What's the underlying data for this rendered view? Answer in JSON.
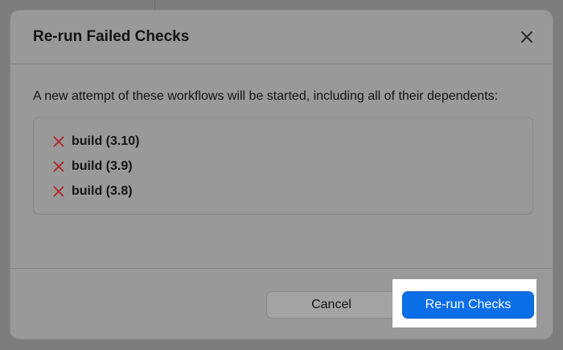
{
  "dialog": {
    "title": "Re-run Failed Checks",
    "description": "A new attempt of these workflows will be started, including all of their dependents:",
    "workflows": [
      {
        "name": "build (3.10)",
        "status": "failed"
      },
      {
        "name": "build (3.9)",
        "status": "failed"
      },
      {
        "name": "build (3.8)",
        "status": "failed"
      }
    ],
    "cancel_label": "Cancel",
    "confirm_label": "Re-run Checks"
  },
  "colors": {
    "accent": "#0a6ee6",
    "fail": "#b0222a",
    "overlay": "#999999"
  },
  "icons": {
    "close": "close-icon",
    "fail": "x-fail-icon"
  }
}
